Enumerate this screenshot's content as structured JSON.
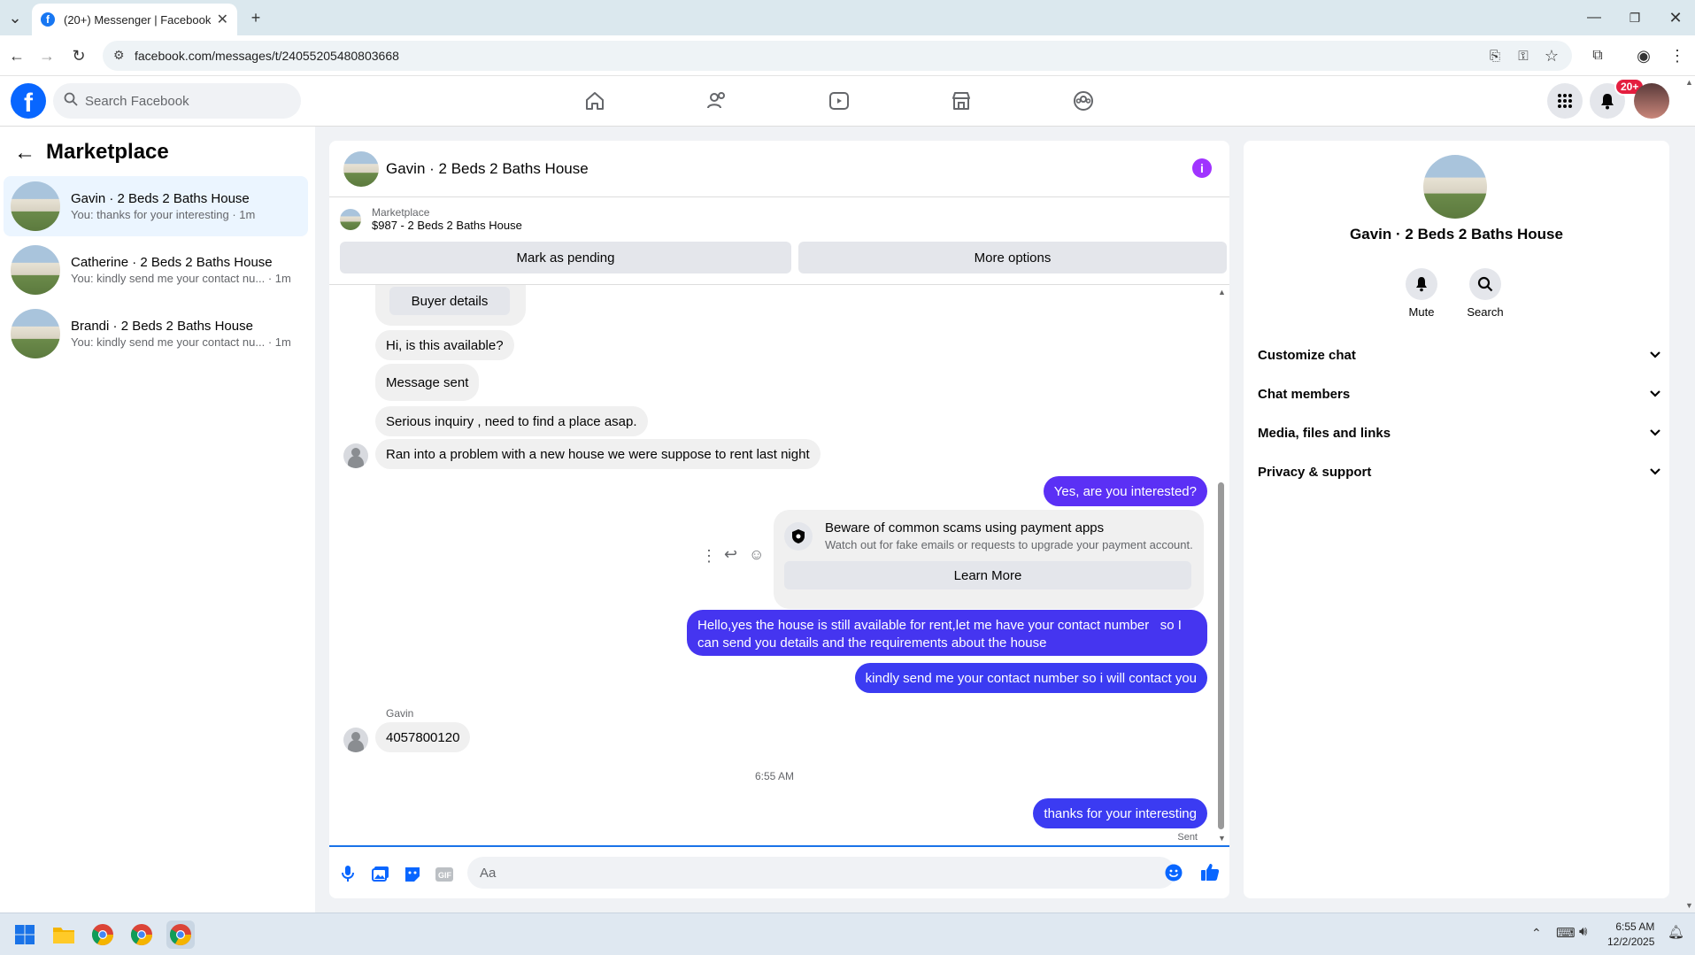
{
  "browser": {
    "tab_title": "(20+) Messenger | Facebook",
    "url": "facebook.com/messages/t/24055205480803668"
  },
  "header": {
    "search_placeholder": "Search Facebook",
    "notification_badge": "20+"
  },
  "sidebar": {
    "title": "Marketplace",
    "conversations": [
      {
        "title": "Gavin · 2 Beds 2 Baths House",
        "preview": "You: thanks for your interesting · 1m",
        "active": true
      },
      {
        "title": "Catherine · 2 Beds 2 Baths House",
        "preview": "You: kindly send me your contact nu... · 1m",
        "active": false
      },
      {
        "title": "Brandi · 2 Beds 2 Baths House",
        "preview": "You: kindly send me your contact nu... · 1m",
        "active": false
      }
    ]
  },
  "chat": {
    "title": "Gavin · 2 Beds 2 Baths House",
    "listing_source": "Marketplace",
    "listing_price_title": "$987 - 2 Beds 2 Baths House",
    "mark_pending": "Mark as pending",
    "more_options": "More options",
    "buyer_details": "Buyer details",
    "messages": {
      "m1": "Hi, is this available?",
      "m2": "Message sent",
      "m3": "Serious inquiry , need to find a place asap.",
      "m4": "Ran into a problem with a new house we were suppose to rent last night",
      "m5": "Yes, are you interested?",
      "m6_line1": "Hello,yes the house is still available for rent,let me have your contact number   so I",
      "m6_line2": "can send you details and the requirements about the house",
      "m7": "kindly send me your contact number so i will contact you",
      "sender_name": "Gavin",
      "m8": "4057800120",
      "timestamp": "6:55 AM",
      "m9": "thanks for your interesting",
      "status": "Sent"
    },
    "scam_card": {
      "title": "Beware of common scams using payment apps",
      "body": "Watch out for fake emails or requests to upgrade your payment account.",
      "button": "Learn More"
    },
    "composer_placeholder": "Aa"
  },
  "details": {
    "name": "Gavin · 2 Beds 2 Baths House",
    "mute_label": "Mute",
    "search_label": "Search",
    "sections": [
      "Customize chat",
      "Chat members",
      "Media, files and links",
      "Privacy & support"
    ]
  },
  "taskbar": {
    "time": "6:55 AM",
    "date": "12/2/2025"
  },
  "colors": {
    "outgoing_bubble": "#5b30f5",
    "brand": "#0866ff",
    "active_conversation": "#ebf5ff"
  }
}
